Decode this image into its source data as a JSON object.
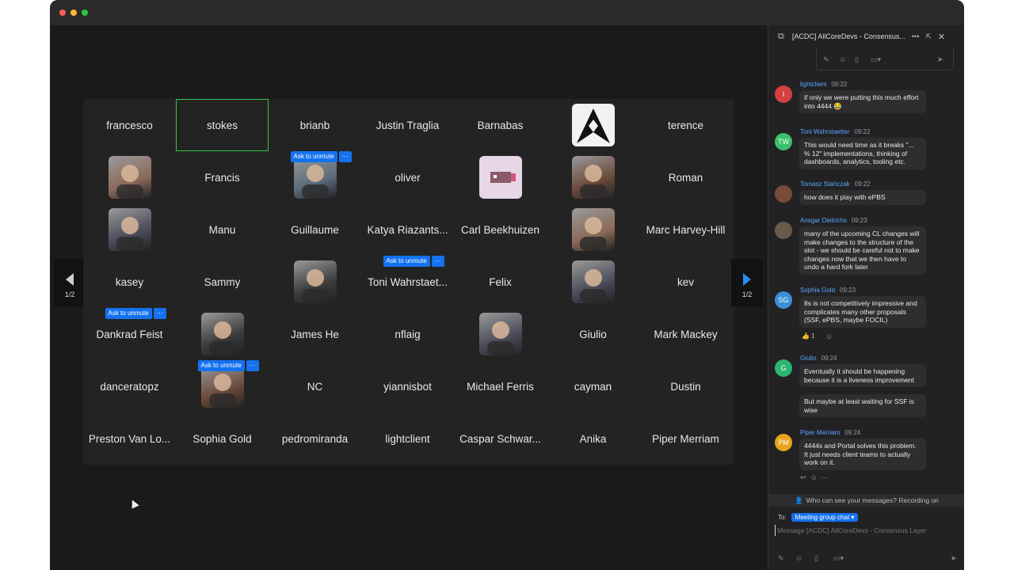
{
  "window": {
    "traffic_colors": [
      "#ff5f57",
      "#febc2e",
      "#28c840"
    ]
  },
  "gallery": {
    "page_indicator_left": "1/2",
    "page_indicator_right": "1/2",
    "unmute_label": "Ask to unmute",
    "more_label": "···",
    "participants": [
      {
        "name": "francesco",
        "row": 0,
        "col": 0
      },
      {
        "name": "stokes",
        "row": 0,
        "col": 1,
        "active": true
      },
      {
        "name": "brianb",
        "row": 0,
        "col": 2
      },
      {
        "name": "Justin Traglia",
        "row": 0,
        "col": 3
      },
      {
        "name": "Barnabas",
        "row": 0,
        "col": 4
      },
      {
        "name": "",
        "row": 0,
        "col": 5,
        "avatar": "logo"
      },
      {
        "name": "terence",
        "row": 0,
        "col": 6
      },
      {
        "name": "",
        "row": 1,
        "col": 0,
        "avatar": "photo"
      },
      {
        "name": "Francis",
        "row": 1,
        "col": 1
      },
      {
        "name": "",
        "row": 1,
        "col": 2,
        "avatar": "photo",
        "unmute": true
      },
      {
        "name": "oliver",
        "row": 1,
        "col": 3
      },
      {
        "name": "",
        "row": 1,
        "col": 4,
        "avatar": "pixel"
      },
      {
        "name": "",
        "row": 1,
        "col": 5,
        "avatar": "photo"
      },
      {
        "name": "Roman",
        "row": 1,
        "col": 6
      },
      {
        "name": "",
        "row": 2,
        "col": 0,
        "avatar": "photo"
      },
      {
        "name": "Manu",
        "row": 2,
        "col": 1
      },
      {
        "name": "Guillaume",
        "row": 2,
        "col": 2
      },
      {
        "name": "Katya Riazants...",
        "row": 2,
        "col": 3
      },
      {
        "name": "Carl Beekhuizen",
        "row": 2,
        "col": 4
      },
      {
        "name": "",
        "row": 2,
        "col": 5,
        "avatar": "photo"
      },
      {
        "name": "Marc Harvey-Hill",
        "row": 2,
        "col": 6
      },
      {
        "name": "kasey",
        "row": 3,
        "col": 0
      },
      {
        "name": "Sammy",
        "row": 3,
        "col": 1
      },
      {
        "name": "",
        "row": 3,
        "col": 2,
        "avatar": "photo"
      },
      {
        "name": "Toni Wahrstaet...",
        "row": 3,
        "col": 3,
        "unmute": true
      },
      {
        "name": "Felix",
        "row": 3,
        "col": 4
      },
      {
        "name": "",
        "row": 3,
        "col": 5,
        "avatar": "photo"
      },
      {
        "name": "kev",
        "row": 3,
        "col": 6
      },
      {
        "name": "Dankrad Feist",
        "row": 4,
        "col": 0,
        "unmute": true
      },
      {
        "name": "",
        "row": 4,
        "col": 1,
        "avatar": "photo"
      },
      {
        "name": "James He",
        "row": 4,
        "col": 2
      },
      {
        "name": "nflaig",
        "row": 4,
        "col": 3
      },
      {
        "name": "",
        "row": 4,
        "col": 4,
        "avatar": "photo"
      },
      {
        "name": "Giulio",
        "row": 4,
        "col": 5
      },
      {
        "name": "Mark Mackey",
        "row": 4,
        "col": 6
      },
      {
        "name": "danceratopz",
        "row": 5,
        "col": 0
      },
      {
        "name": "",
        "row": 5,
        "col": 1,
        "avatar": "photo",
        "unmute": true
      },
      {
        "name": "NC",
        "row": 5,
        "col": 2
      },
      {
        "name": "yiannisbot",
        "row": 5,
        "col": 3
      },
      {
        "name": "Michael Ferris",
        "row": 5,
        "col": 4
      },
      {
        "name": "cayman",
        "row": 5,
        "col": 5
      },
      {
        "name": "Dustin",
        "row": 5,
        "col": 6
      },
      {
        "name": "Preston Van Lo...",
        "row": 6,
        "col": 0
      },
      {
        "name": "Sophia Gold",
        "row": 6,
        "col": 1
      },
      {
        "name": "pedromiranda",
        "row": 6,
        "col": 2
      },
      {
        "name": "lightclient",
        "row": 6,
        "col": 3
      },
      {
        "name": "Caspar Schwar...",
        "row": 6,
        "col": 4
      },
      {
        "name": "Anika",
        "row": 6,
        "col": 5
      },
      {
        "name": "Piper Merriam",
        "row": 6,
        "col": 6
      }
    ]
  },
  "chat": {
    "title": "[ACDC] AllCoreDevs - Consensus...",
    "messages": [
      {
        "initials": "l",
        "color": "#d64040",
        "name": "lightclient",
        "time": "09:22",
        "bubbles": [
          "if only we were putting this much effort into 4444 😂"
        ]
      },
      {
        "initials": "TW",
        "color": "#3bbf6a",
        "name": "Toni Wahrstaetter",
        "time": "09:22",
        "bubbles": [
          "This would need time as it breaks \"... % 12\" implementations, thinking of dashboards, analytics, tooling etc."
        ]
      },
      {
        "initials": "",
        "color": "#7a4a3a",
        "name": "Tomasz Stańczak",
        "time": "09:22",
        "bubbles": [
          "how does it play with ePBS"
        ]
      },
      {
        "initials": "",
        "color": "#6a5a4a",
        "name": "Ansgar Dietrichs",
        "time": "09:23",
        "bubbles": [
          "many of the upcoming CL changes will make changes to the structure of the slot - we should be careful not to make changes now that we then have to undo a hard fork later"
        ]
      },
      {
        "initials": "SG",
        "color": "#3b8fd6",
        "name": "Sophia Gold",
        "time": "09:23",
        "bubbles": [
          "8s is not competitively impressive and complicates many other proposals (SSF, ePBS, maybe FOCIL)"
        ],
        "reaction": "👍 1"
      },
      {
        "initials": "G",
        "color": "#2bb673",
        "name": "Giulio",
        "time": "09:24",
        "bubbles": [
          "Eventually it should be happening because it is a liveness improvement",
          "But maybe at least waiting for SSF is wise"
        ]
      },
      {
        "initials": "PM",
        "color": "#e8a41c",
        "name": "Piper Merriam",
        "time": "09:24",
        "bubbles": [
          "4444s and Portal solves this problem. It just needs client teams to actually work on it."
        ]
      }
    ],
    "visibility_notice": "Who can see your messages? Recording on",
    "to_label": "To:",
    "recipient": "Meeting group chat",
    "input_placeholder": "Message [ACDC] AllCoreDevs - Consensus Layer"
  }
}
